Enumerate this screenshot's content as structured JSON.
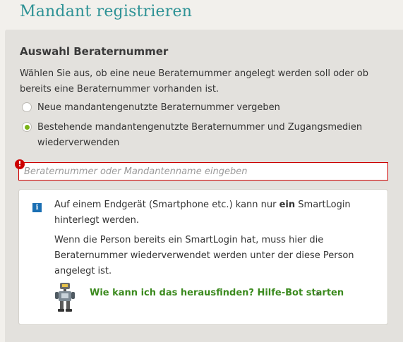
{
  "header": {
    "title": "Mandant registrieren"
  },
  "section": {
    "heading": "Auswahl Beraternummer",
    "description": "Wählen Sie aus, ob eine neue Beraternummer angelegt werden soll oder ob bereits eine Beraternummer vorhanden ist."
  },
  "options": [
    {
      "label": "Neue mandantengenutzte Beraternummer vergeben",
      "selected": false
    },
    {
      "label": "Bestehende mandantengenutzte Beraternummer und Zugangsmedien wiederverwenden",
      "selected": true
    }
  ],
  "search": {
    "placeholder": "Beraternummer oder Mandantenname eingeben",
    "value": "",
    "error_icon": "!"
  },
  "info": {
    "icon": "i",
    "p1_before": "Auf einem Endgerät (Smartphone etc.) kann nur ",
    "p1_bold": "ein",
    "p1_after": " SmartLogin hinterlegt werden.",
    "p2": "Wenn die Person bereits ein SmartLogin hat, muss hier die Beraternummer wiederverwendet werden unter der diese Person angelegt ist.",
    "bot_link": "Wie kann ich das herausfinden? Hilfe-Bot starten",
    "chevron": "›"
  },
  "colors": {
    "title": "#2d9295",
    "accent_green": "#7ab317",
    "link_green": "#3b8a1e",
    "error_red": "#cc0000",
    "info_blue": "#1a6fb3"
  },
  "icons": [
    "error-icon",
    "info-icon",
    "robot-icon",
    "chevron-right-icon"
  ]
}
